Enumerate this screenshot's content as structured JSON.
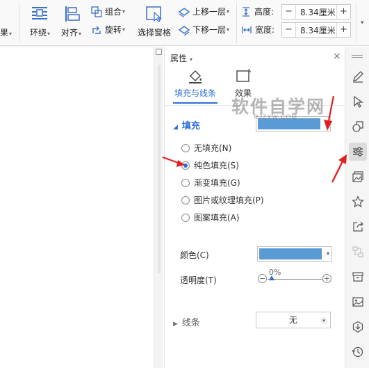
{
  "ribbon": {
    "cut_label": "效果",
    "wrap_label": "环绕",
    "align_label": "对齐",
    "group_label": "组合",
    "rotate_label": "旋转",
    "select_pane_label": "选择窗格",
    "bring_forward_label": "上移一层",
    "send_backward_label": "下移一层",
    "height_label": "高度:",
    "height_value": "8.34厘米",
    "width_label": "宽度:",
    "width_value": "8.34厘米",
    "minus": "−",
    "plus": "+",
    "dropdown_arrow": "▾"
  },
  "panel": {
    "title": "属性",
    "title_arrow": "▾",
    "close": "×",
    "tabs": [
      {
        "label": "填充与线条",
        "active": true
      },
      {
        "label": "效果",
        "active": false
      }
    ],
    "fill": {
      "section_label": "填充",
      "current_color": "#5b9bd5",
      "options": [
        {
          "label": "无填充(N)",
          "checked": false
        },
        {
          "label": "纯色填充(S)",
          "checked": true
        },
        {
          "label": "渐变填充(G)",
          "checked": false
        },
        {
          "label": "图片或纹理填充(P)",
          "checked": false
        },
        {
          "label": "图案填充(A)",
          "checked": false
        }
      ],
      "color_label": "颜色(C)",
      "color_value": "#5b9bd5",
      "transparency_label": "透明度(T)",
      "transparency_value": "0%",
      "transparency_fraction": 0
    },
    "line": {
      "section_label": "线条",
      "value": "无"
    }
  },
  "watermark": {
    "text": "软件自学网",
    "url": "RJZXW.COM"
  },
  "colors": {
    "accent": "#2d6fd8",
    "fill_blue": "#5b9bd5",
    "arrow_red": "#e02020"
  },
  "right_toolbar": [
    "pen-icon",
    "cursor-icon",
    "shapes-icon",
    "properties-icon",
    "picture-icon",
    "star-icon",
    "share-icon",
    "flow-icon",
    "archive-icon",
    "image-icon",
    "shield-icon",
    "history-icon"
  ]
}
